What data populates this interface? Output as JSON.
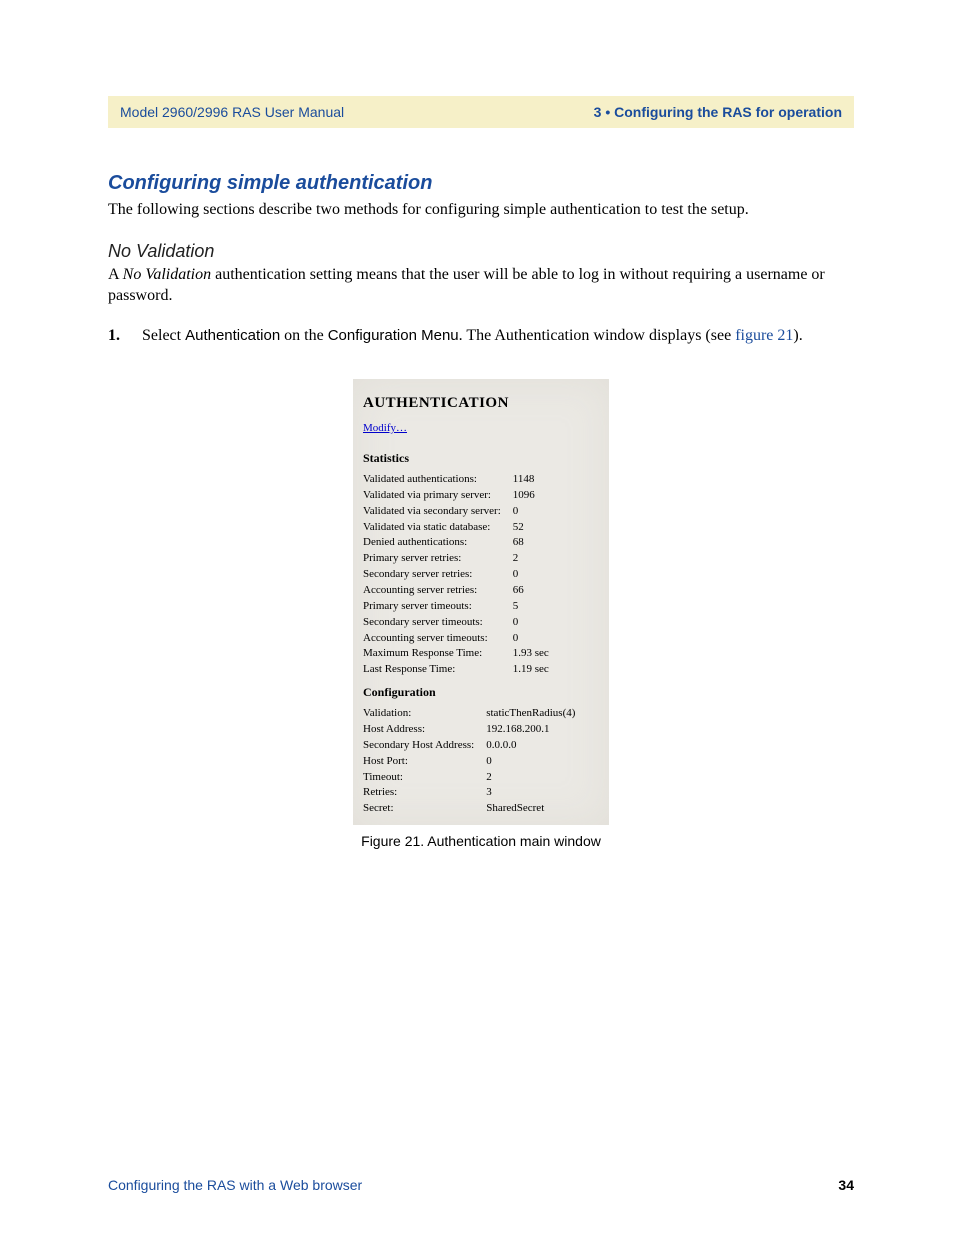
{
  "header": {
    "left": "Model 2960/2996 RAS User Manual",
    "right": "3 • Configuring the RAS for operation"
  },
  "section_title": "Configuring simple authentication",
  "intro": "The following sections describe two methods for configuring simple authentication to test the setup.",
  "sub_heading": "No Validation",
  "no_validation_prefix": "A ",
  "no_validation_term": "No Validation",
  "no_validation_suffix": " authentication setting means that the user will be able to log in without requiring a username or password.",
  "step1": {
    "num": "1.",
    "pre": "Select ",
    "sans1": "Authentication",
    "mid1": " on the ",
    "sans2": "Configuration Menu",
    "mid2": ". The Authentication window displays (see ",
    "figref": "figure 21",
    "tail": ")."
  },
  "fig": {
    "title": "AUTHENTICATION",
    "modify": "Modify…",
    "stats_heading": "Statistics",
    "stats": [
      {
        "label": "Validated authentications:",
        "value": "1148"
      },
      {
        "label": "Validated via primary server:",
        "value": "1096"
      },
      {
        "label": "Validated via secondary server:",
        "value": "0"
      },
      {
        "label": "Validated via static database:",
        "value": "52"
      },
      {
        "label": "Denied authentications:",
        "value": "68"
      },
      {
        "label": "Primary server retries:",
        "value": "2"
      },
      {
        "label": "Secondary server retries:",
        "value": "0"
      },
      {
        "label": "Accounting server retries:",
        "value": "66"
      },
      {
        "label": "Primary server timeouts:",
        "value": "5"
      },
      {
        "label": "Secondary server timeouts:",
        "value": "0"
      },
      {
        "label": "Accounting server timeouts:",
        "value": "0"
      },
      {
        "label": "Maximum Response Time:",
        "value": "1.93 sec"
      },
      {
        "label": "Last Response Time:",
        "value": "1.19 sec"
      }
    ],
    "config_heading": "Configuration",
    "config": [
      {
        "label": "Validation:",
        "value": "staticThenRadius(4)"
      },
      {
        "label": "Host Address:",
        "value": "192.168.200.1"
      },
      {
        "label": "Secondary Host Address:",
        "value": "0.0.0.0"
      },
      {
        "label": "Host Port:",
        "value": "0"
      },
      {
        "label": "Timeout:",
        "value": "2"
      },
      {
        "label": "Retries:",
        "value": "3"
      },
      {
        "label": "Secret:",
        "value": "SharedSecret"
      }
    ],
    "caption": "Figure 21. Authentication main window"
  },
  "footer": {
    "left": "Configuring the RAS with a Web browser",
    "page": "34"
  }
}
